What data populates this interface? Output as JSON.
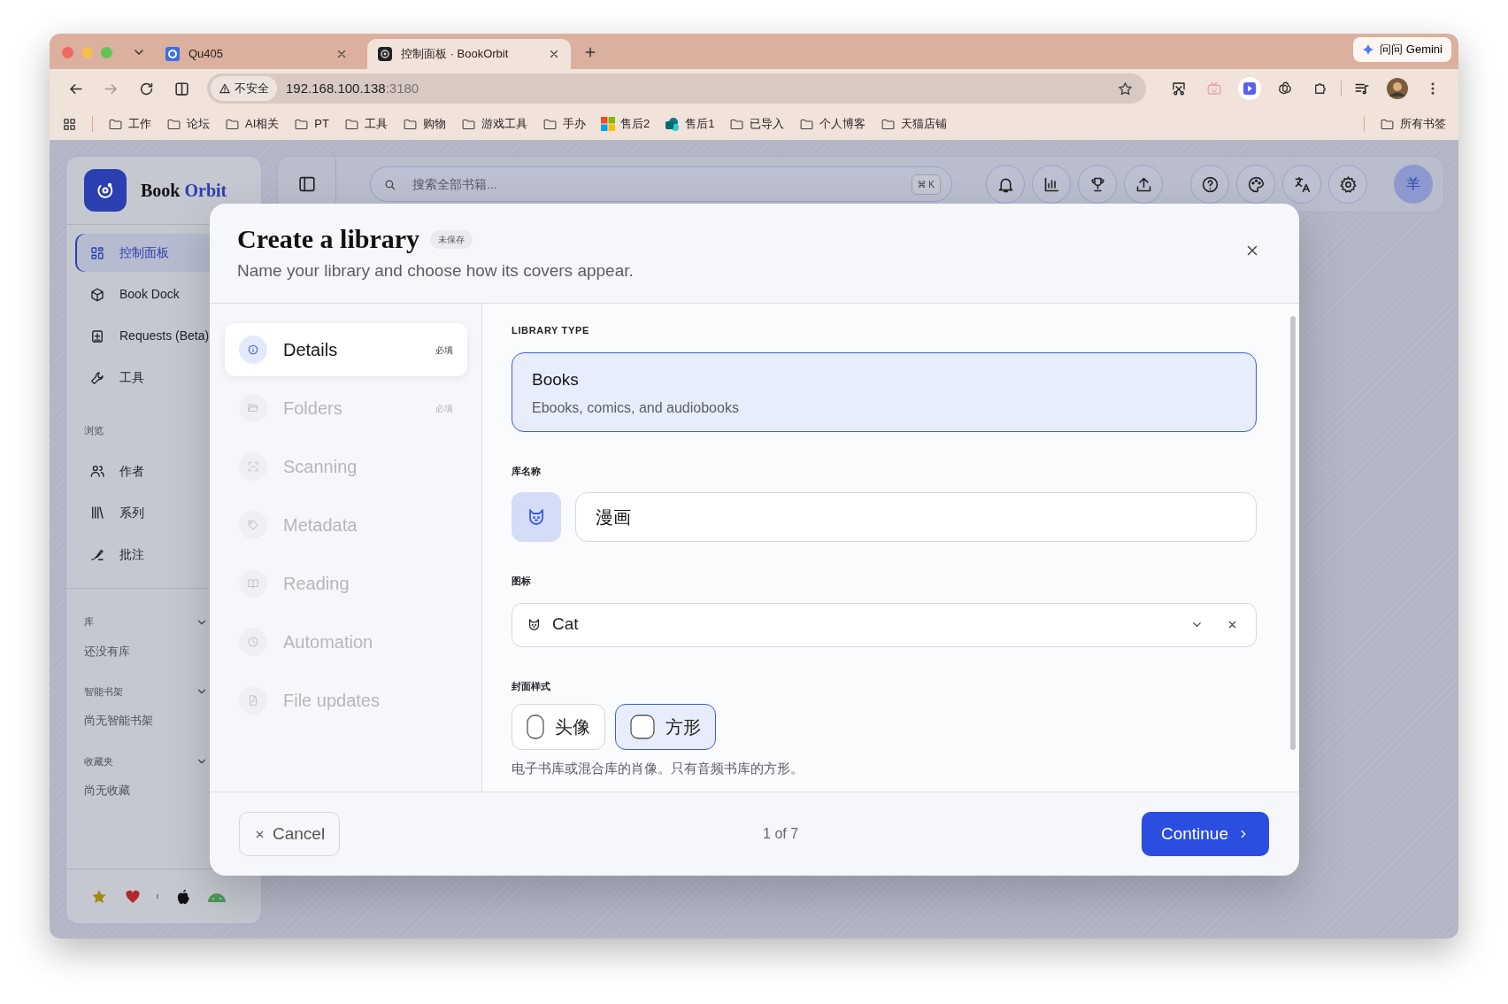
{
  "browser": {
    "tabs": [
      {
        "title": "Qu405",
        "selected": false
      },
      {
        "title": "控制面板 · BookOrbit",
        "selected": true
      }
    ],
    "gemini_button": "问问 Gemini",
    "address": {
      "security": "不安全",
      "host": "192.168.100.138",
      "port": ":3180"
    },
    "bookmarks": [
      {
        "label": "工作",
        "kind": "folder"
      },
      {
        "label": "论坛",
        "kind": "folder"
      },
      {
        "label": "AI相关",
        "kind": "folder"
      },
      {
        "label": "PT",
        "kind": "folder"
      },
      {
        "label": "工具",
        "kind": "folder"
      },
      {
        "label": "购物",
        "kind": "folder"
      },
      {
        "label": "游戏工具",
        "kind": "folder"
      },
      {
        "label": "手办",
        "kind": "folder"
      },
      {
        "label": "售后2",
        "kind": "tiles"
      },
      {
        "label": "售后1",
        "kind": "site"
      },
      {
        "label": "已导入",
        "kind": "folder"
      },
      {
        "label": "个人博客",
        "kind": "folder"
      },
      {
        "label": "天猫店铺",
        "kind": "folder"
      }
    ],
    "all_bookmarks": "所有书签"
  },
  "app": {
    "brand": {
      "name": "Book",
      "accent": "Orbit"
    },
    "nav": [
      {
        "label": "控制面板",
        "selected": true
      },
      {
        "label": "Book Dock",
        "selected": false
      },
      {
        "label": "Requests (Beta)",
        "selected": false
      },
      {
        "label": "工具",
        "selected": false
      }
    ],
    "browse": {
      "title": "浏览",
      "items": [
        {
          "label": "作者",
          "selected": false
        },
        {
          "label": "系列",
          "selected": false
        },
        {
          "label": "批注",
          "selected": false
        }
      ]
    },
    "groups": [
      {
        "title": "库",
        "expanded": true,
        "empty_text": "还没有库"
      },
      {
        "title": "智能书架",
        "expanded": true,
        "empty_text": "尚无智能书架"
      },
      {
        "title": "收藏夹",
        "expanded": true,
        "empty_text": "尚无收藏"
      }
    ],
    "search": {
      "placeholder": "搜索全部书籍...",
      "shortcut": "⌘ K"
    },
    "user_avatar": "羊"
  },
  "modal": {
    "title": "Create a library",
    "status_badge": "未保存",
    "subtitle": "Name your library and choose how its covers appear.",
    "steps": [
      {
        "label": "Details",
        "badge": "必填",
        "selected": true
      },
      {
        "label": "Folders",
        "badge": "必填",
        "selected": false
      },
      {
        "label": "Scanning",
        "selected": false
      },
      {
        "label": "Metadata",
        "selected": false
      },
      {
        "label": "Reading",
        "selected": false
      },
      {
        "label": "Automation",
        "selected": false
      },
      {
        "label": "File updates",
        "selected": false
      }
    ],
    "library_type": {
      "label": "LIBRARY TYPE",
      "options": [
        {
          "title": "Books",
          "description": "Ebooks, comics, and audiobooks",
          "selected": true
        }
      ]
    },
    "name_field": {
      "label": "库名称",
      "value": "漫画"
    },
    "icon_field": {
      "label": "图标",
      "value": "Cat"
    },
    "cover_style": {
      "label": "封面样式",
      "options": [
        {
          "label": "头像",
          "selected": false
        },
        {
          "label": "方形",
          "selected": true
        }
      ],
      "hint": "电子书库或混合库的肖像。只有音频书库的方形。"
    },
    "footer": {
      "cancel": "Cancel",
      "progress": "1 of 7",
      "continue": "Continue"
    }
  }
}
